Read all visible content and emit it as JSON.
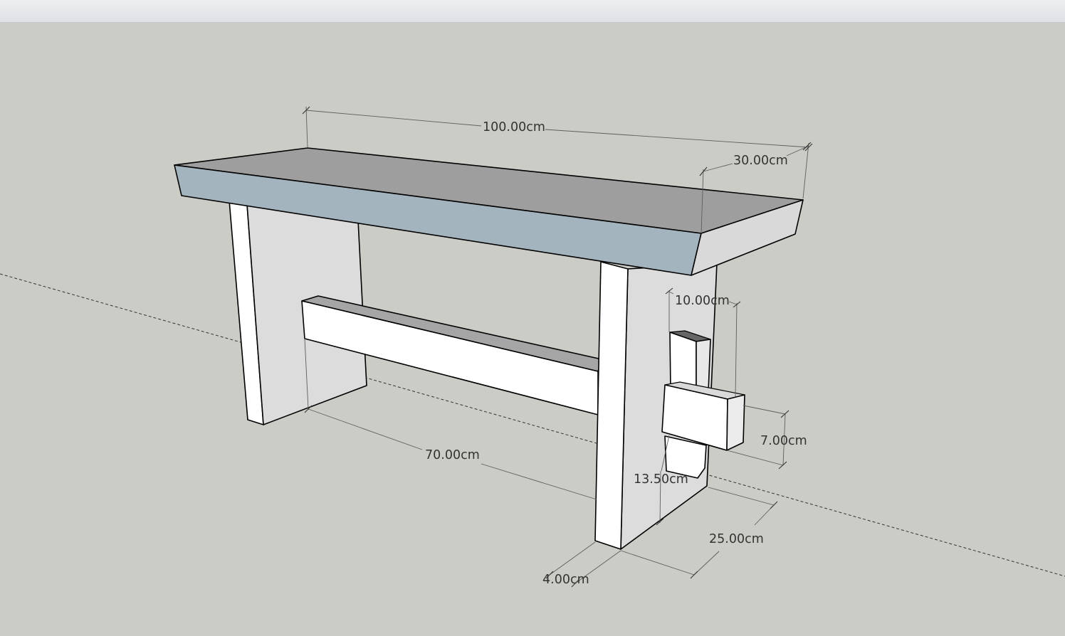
{
  "dimensions": {
    "top_length": "100.00cm",
    "top_depth": "30.00cm",
    "peg_width": "10.00cm",
    "wedge_height": "7.00cm",
    "stretcher_length": "70.00cm",
    "leg_height_lower": "13.50cm",
    "leg_depth": "25.00cm",
    "leg_thickness": "4.00cm"
  },
  "colors": {
    "background": "#cbccc6",
    "top_face": "#9e9e9e",
    "front_edge": "#a4b4bf",
    "end_face": "#d9d9d9",
    "leg_face": "#dcdcdc",
    "white_face": "#ffffff"
  }
}
